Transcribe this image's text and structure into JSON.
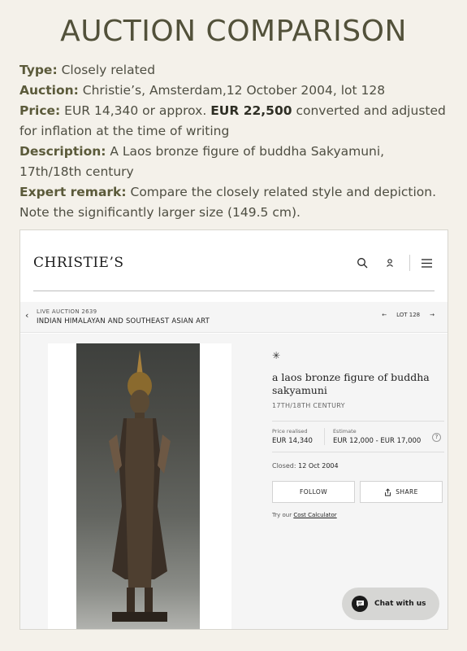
{
  "heading": "AUCTION COMPARISON",
  "info": {
    "type_label": "Type:",
    "type_value": "Closely related",
    "auction_label": "Auction:",
    "auction_value": "Christie’s, Amsterdam,12 October 2004, lot 128",
    "price_label": "Price:",
    "price_prefix": "EUR 14,340 or approx.",
    "price_highlight": "EUR 22,500",
    "price_suffix": "converted and adjusted for inflation at the time of writing",
    "description_label": "Description:",
    "description_line1": "A Laos bronze figure of buddha Sakyamuni,",
    "description_line2": "17th/18th century",
    "remark_label": "Expert remark:",
    "remark_value": "Compare the closely related style and depiction. Note the significantly larger size (149.5 cm)."
  },
  "screenshot": {
    "logo": "CHRISTIE’S",
    "icons": [
      "search-icon",
      "user-icon",
      "menu-icon"
    ],
    "breadcrumb": {
      "back_arrow": "‹",
      "sub": "LIVE AUCTION 2639",
      "main": "INDIAN HIMALAYAN AND SOUTHEAST ASIAN ART",
      "prev_arrow": "←",
      "lot": "LOT 128",
      "next_arrow": "→"
    },
    "lot": {
      "star": "✳",
      "title": "a laos bronze figure of buddha sakyamuni",
      "century": "17TH/18TH CENTURY",
      "price_realised_label": "Price realised",
      "price_realised_value": "EUR 14,340",
      "estimate_label": "Estimate",
      "estimate_value": "EUR 12,000 - EUR 17,000",
      "help": "?",
      "closed_label": "Closed:",
      "closed_value": "12 Oct 2004",
      "follow_label": "FOLLOW",
      "share_label": "SHARE",
      "calc_prefix": "Try our",
      "calc_link": "Cost Calculator"
    },
    "chat_label": "Chat with us"
  }
}
